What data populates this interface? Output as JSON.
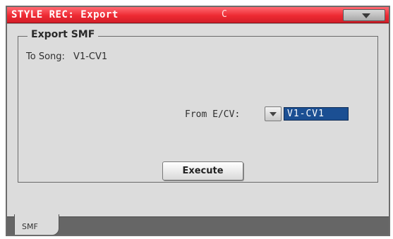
{
  "window": {
    "title": "STYLE REC: Export",
    "key": "C"
  },
  "export_smf": {
    "group_title": "Export SMF",
    "to_song_label": "To Song:",
    "to_song_value": "V1-CV1",
    "from_label": "From E/CV:",
    "from_value": "V1-CV1",
    "execute_label": "Execute"
  },
  "tabs": [
    {
      "label": "SMF",
      "selected": true
    }
  ],
  "colors": {
    "title_bar": "#ee2a33",
    "selected_value_bg": "#1b4f93",
    "panel_bg": "#dcdcdc"
  }
}
